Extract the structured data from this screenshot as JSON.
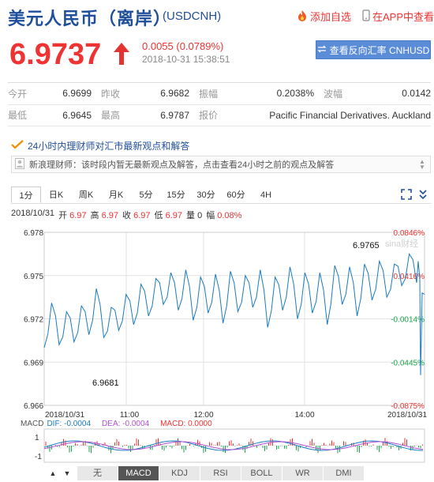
{
  "header": {
    "title": "美元人民币（离岸）",
    "code": "(USDCNH)",
    "add_fav": "添加自选",
    "app_view": "在APP中查看"
  },
  "quote": {
    "price": "6.9737",
    "change": "0.0055 (0.0789%)",
    "time": "2018-10-31 15:38:51",
    "reverse_btn": "查看反向汇率 CNHUSD"
  },
  "stats": {
    "open_label": "今开",
    "open": "6.9699",
    "prev_label": "昨收",
    "prev": "6.9682",
    "amp_label": "振幅",
    "amp": "0.2038%",
    "wave_label": "波幅",
    "wave": "0.0142",
    "low_label": "最低",
    "low": "6.9645",
    "high_label": "最高",
    "high": "6.9787",
    "source_label": "报价",
    "source": "Pacific Financial Derivatives. Auckland"
  },
  "news": {
    "heading": "24小时内理财师对汇市最新观点和解答",
    "text": "新浪理财师：该时段内暂无最新观点及解答，点击查看24小时之前的观点及解答"
  },
  "tabs": [
    "1分",
    "日K",
    "周K",
    "月K",
    "5分",
    "15分",
    "30分",
    "60分",
    "4H"
  ],
  "ohlc": {
    "date": "2018/10/31",
    "open_label": "开",
    "open": "6.97",
    "high_label": "高",
    "high": "6.97",
    "close_label": "收",
    "close": "6.97",
    "low_label": "低",
    "low": "6.97",
    "vol_label": "量",
    "vol": "0",
    "amp_label": "幅",
    "amp": "0.08%"
  },
  "chart_data": {
    "type": "line",
    "ylim": [
      6.966,
      6.978
    ],
    "y_ticks": [
      "6.978",
      "6.975",
      "6.972",
      "6.969",
      "6.966"
    ],
    "pct_ticks": [
      "0.0846%",
      "0.0416%",
      "-0.0014%",
      "-0.0445%",
      "-0.0875%"
    ],
    "x_ticks": [
      "2018/10/31",
      "11:00",
      "12:00",
      "14:00",
      "2018/10/31"
    ],
    "annotations": {
      "max": "6.9765",
      "min": "6.9681"
    },
    "watermark": "sina财经",
    "x": [
      0,
      2,
      4,
      6,
      8,
      10,
      12,
      14,
      16,
      18,
      20,
      22,
      24,
      26,
      28,
      30,
      32,
      34,
      36,
      38,
      40,
      42,
      44,
      46,
      48,
      50,
      52,
      54,
      56,
      58,
      60,
      62,
      64,
      66,
      68,
      70,
      72,
      74,
      76,
      78,
      80,
      82,
      84,
      86,
      88,
      90,
      92,
      94,
      96,
      98,
      100
    ],
    "values": [
      6.97,
      6.9731,
      6.9702,
      6.9725,
      6.9704,
      6.9729,
      6.9709,
      6.9741,
      6.9707,
      6.9728,
      6.9712,
      6.9737,
      6.9716,
      6.9744,
      6.9722,
      6.9748,
      6.973,
      6.9752,
      6.9726,
      6.9754,
      6.9719,
      6.9749,
      6.9724,
      6.9751,
      6.9717,
      6.9753,
      6.9725,
      6.975,
      6.9728,
      6.9754,
      6.9714,
      6.9749,
      6.9726,
      6.9756,
      6.972,
      6.9752,
      6.9724,
      6.9752,
      6.9716,
      6.9757,
      6.973,
      6.9756,
      6.9722,
      6.9758,
      6.9733,
      6.976,
      6.9735,
      6.9758,
      6.9743,
      6.9765,
      6.9745
    ],
    "tail": [
      6.976,
      6.9748,
      6.9681,
      6.9738,
      6.9737
    ]
  },
  "macd": {
    "label": "MACD",
    "dif": "DIF: -0.0004",
    "dea": "DEA: -0.0004",
    "macd": "MACD: 0.0000",
    "y_ticks": [
      "1",
      "-1"
    ]
  },
  "indicators": [
    "无",
    "MACD",
    "KDJ",
    "RSI",
    "BOLL",
    "WR",
    "DMI"
  ],
  "colors": {
    "accent_red": "#e33333",
    "brand_blue": "#1f4e9a",
    "line_blue": "#1a7bc0",
    "up_green": "#1aa34a"
  }
}
